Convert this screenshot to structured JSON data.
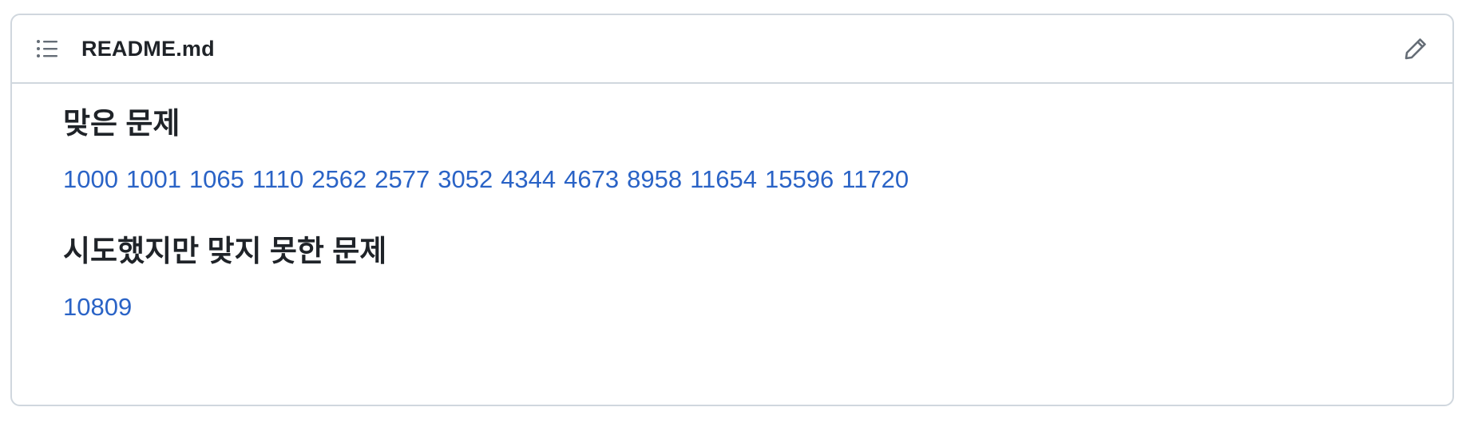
{
  "header": {
    "file_name": "README.md",
    "toc_icon": "list-unordered-icon",
    "edit_icon": "pencil-icon"
  },
  "sections": [
    {
      "heading": "맞은 문제",
      "problems": [
        "1000",
        "1001",
        "1065",
        "1110",
        "2562",
        "2577",
        "3052",
        "4344",
        "4673",
        "8958",
        "11654",
        "15596",
        "11720"
      ]
    },
    {
      "heading": "시도했지만 맞지 못한 문제",
      "problems": [
        "10809"
      ]
    }
  ],
  "colors": {
    "link": "#2a63c6",
    "text": "#1f2328",
    "border": "#d0d7de",
    "icon": "#656d76"
  }
}
